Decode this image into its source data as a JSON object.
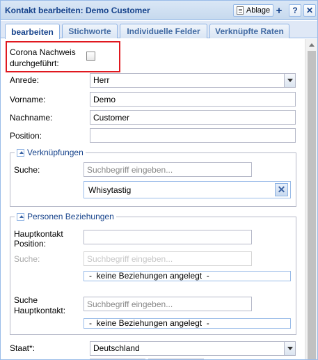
{
  "window": {
    "title": "Kontakt bearbeiten: Demo Customer",
    "ablage_label": "Ablage",
    "plus_label": "+",
    "help_label": "?",
    "close_label": "✕"
  },
  "tabs": [
    {
      "label": "bearbeiten",
      "active": true
    },
    {
      "label": "Stichworte",
      "active": false
    },
    {
      "label": "Individuelle Felder",
      "active": false
    },
    {
      "label": "Verknüpfte Raten",
      "active": false
    }
  ],
  "form": {
    "corona": {
      "label_line1": "Corona Nachweis",
      "label_line2": "durchgeführt:",
      "checked": false
    },
    "anrede": {
      "label": "Anrede:",
      "value": "Herr"
    },
    "vorname": {
      "label": "Vorname:",
      "value": "Demo"
    },
    "nachname": {
      "label": "Nachname:",
      "value": "Customer"
    },
    "position": {
      "label": "Position:",
      "value": ""
    },
    "verknuepfungen": {
      "legend": "Verknüpfungen",
      "suche_label": "Suche:",
      "suche_placeholder": "Suchbegriff eingeben...",
      "tag": "Whisytastig",
      "remove_label": "✕"
    },
    "beziehungen": {
      "legend": "Personen Beziehungen",
      "hauptkontakt_position_line1": "Hauptkontakt",
      "hauptkontakt_position_line2": "Position:",
      "hauptkontakt_position_value": "",
      "suche_label": "Suche:",
      "suche_placeholder": "Suchbegriff eingeben...",
      "empty_text_1": "-  keine Beziehungen angelegt  -",
      "suche_hauptkontakt_line1": "Suche",
      "suche_hauptkontakt_line2": "Hauptkontakt:",
      "suche_hauptkontakt_placeholder": "Suchbegriff eingeben...",
      "empty_text_2": "-  keine Beziehungen angelegt  -"
    },
    "staat": {
      "label": "Staat*:",
      "value": "Deutschland"
    }
  }
}
